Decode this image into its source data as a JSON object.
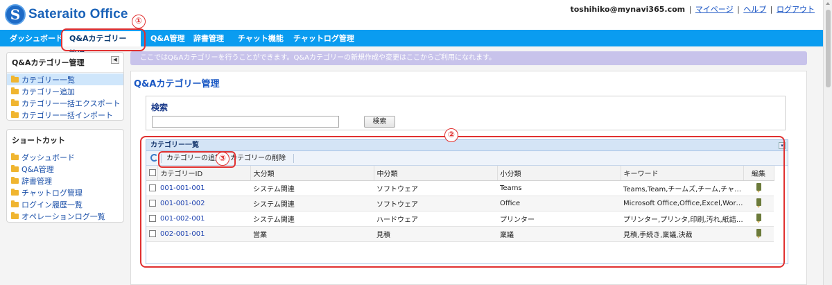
{
  "header": {
    "logo_mark": "S",
    "logo_text": "Sateraito Office",
    "user_email": "toshihiko@mynavi365.com",
    "links": [
      "マイページ",
      "ヘルプ",
      "ログアウト"
    ]
  },
  "nav": {
    "tabs": [
      {
        "label": "ダッシュボード"
      },
      {
        "label": "Q&Aカテゴリー管理"
      },
      {
        "label": "Q&A管理"
      },
      {
        "label": "辞書管理"
      },
      {
        "label": "チャット機能"
      },
      {
        "label": "チャットログ管理"
      }
    ],
    "active": "Q&Aカテゴリー管理"
  },
  "sidebar": {
    "menu_title": "Q&Aカテゴリー管理",
    "collapse_glyph": "◀",
    "menu_items": [
      "カテゴリー一覧",
      "カテゴリー追加",
      "カテゴリー一括エクスポート",
      "カテゴリー一括インポート"
    ],
    "shortcut_title": "ショートカット",
    "shortcut_items": [
      "ダッシュボード",
      "Q&A管理",
      "辞書管理",
      "チャットログ管理",
      "ログイン履歴一覧",
      "オペレーションログ一覧"
    ]
  },
  "main": {
    "info": "ここではQ&Aカテゴリーを行うことができます。Q&Aカテゴリーの新規作成や変更はここからご利用になれます。",
    "title": "Q&Aカテゴリー管理",
    "search": {
      "heading": "検索",
      "value": "",
      "button": "検索"
    },
    "grid": {
      "title": "カテゴリー一覧",
      "toolbar": {
        "add": "カテゴリーの追加",
        "delete": "カテゴリーの削除"
      },
      "columns": [
        "カテゴリーID",
        "大分類",
        "中分類",
        "小分類",
        "キーワード",
        "編集"
      ],
      "rows": [
        [
          "001-001-001",
          "システム関連",
          "ソフトウェア",
          "Teams",
          "Teams,Team,チームズ,チーム,チャット,ビデオ会議"
        ],
        [
          "001-001-002",
          "システム関連",
          "ソフトウェア",
          "Office",
          "Microsoft Office,Office,Excel,Word,PowerPoint"
        ],
        [
          "001-002-001",
          "システム関連",
          "ハードウェア",
          "プリンター",
          "プリンター,プリンタ,印刷,汚れ,紙詰まり"
        ],
        [
          "002-001-001",
          "営業",
          "見積",
          "稟議",
          "見積,手続き,稟議,決裁"
        ]
      ]
    }
  },
  "annotations": [
    "①",
    "②",
    "③"
  ],
  "colors": {
    "nav": "#0a9cf0",
    "accent": "#1a58c4",
    "annotation": "#e03030",
    "info_bar": "#c8c3eb"
  },
  "icons": [
    "logo-icon",
    "folder-icon",
    "refresh-icon",
    "edit-icon",
    "collapse-icon"
  ]
}
